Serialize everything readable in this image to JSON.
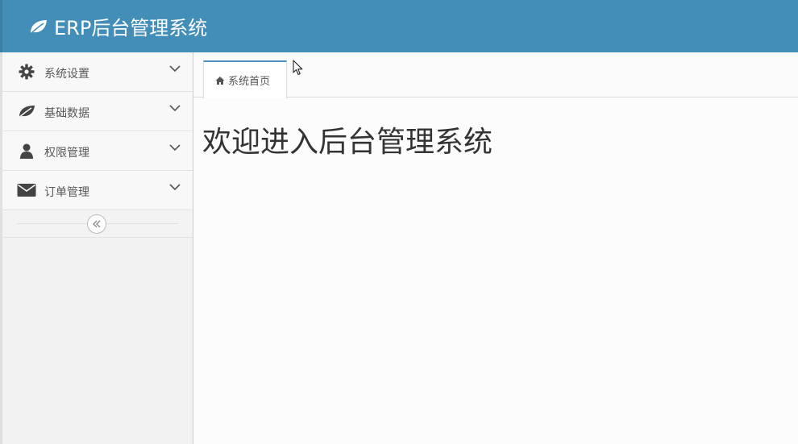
{
  "app": {
    "title": "ERP后台管理系统",
    "icon": "leaf-icon"
  },
  "sidebar": {
    "items": [
      {
        "label": "系统设置",
        "icon": "gear-icon"
      },
      {
        "label": "基础数据",
        "icon": "leaf-icon"
      },
      {
        "label": "权限管理",
        "icon": "user-icon"
      },
      {
        "label": "订单管理",
        "icon": "envelope-icon"
      }
    ],
    "collapse_icon": "double-chevron-left-icon"
  },
  "tabs": [
    {
      "label": "系统首页",
      "icon": "home-icon",
      "active": true
    }
  ],
  "main": {
    "welcome": "欢迎进入后台管理系统"
  },
  "colors": {
    "navbar": "#438eb9",
    "tab_accent": "#4c8fbd",
    "sidebar_bg": "#f2f2f2"
  }
}
